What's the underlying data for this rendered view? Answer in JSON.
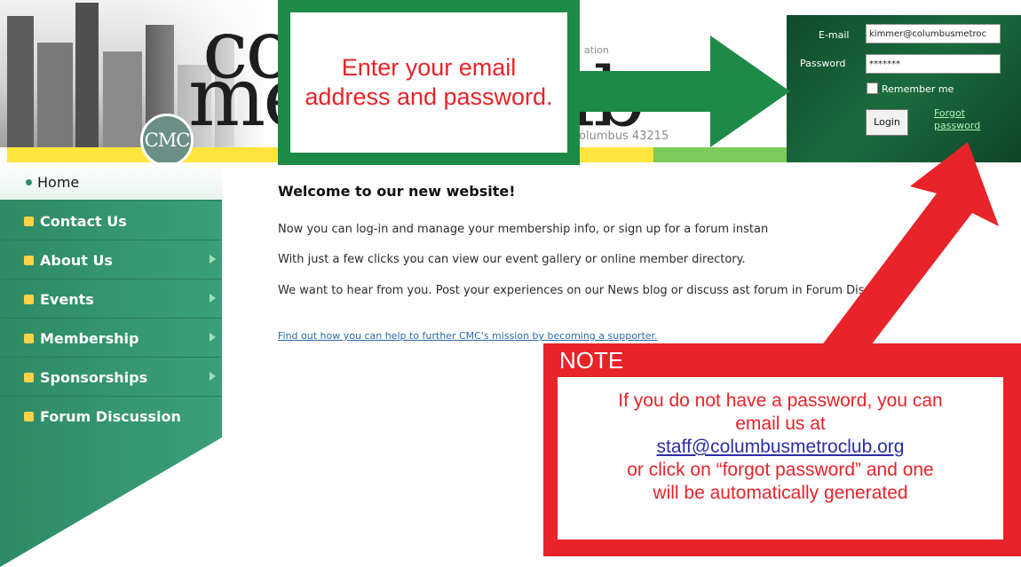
{
  "header": {
    "logo_badge": "CMC",
    "logo_word_1": "colu",
    "logo_word_2": "me",
    "logo_word_3": "ub",
    "tagline": "ation",
    "address": "olumbus 43215"
  },
  "login": {
    "email_label": "E-mail",
    "email_value": "kimmer@columbusmetroc",
    "password_label": "Password",
    "password_value": "*******",
    "remember_label": "Remember me",
    "login_button": "Login",
    "forgot_link": "Forgot password"
  },
  "nav": [
    {
      "label": "Home",
      "has_submenu": false,
      "active": true
    },
    {
      "label": "Contact Us",
      "has_submenu": false,
      "active": false
    },
    {
      "label": "About Us",
      "has_submenu": true,
      "active": false
    },
    {
      "label": "Events",
      "has_submenu": true,
      "active": false
    },
    {
      "label": "Membership",
      "has_submenu": true,
      "active": false
    },
    {
      "label": "Sponsorships",
      "has_submenu": true,
      "active": false
    },
    {
      "label": "Forum Discussion",
      "has_submenu": false,
      "active": false
    }
  ],
  "content": {
    "heading": "Welcome to our new website!",
    "para_1": "Now you can log-in and manage your membership info, or sign up for a forum instan",
    "para_2": "With just a few clicks you can view our event gallery or online member directory.",
    "para_3": "We want to hear from you.  Post your experiences on our News blog or discuss      ast forum in Forum Discussion.",
    "supporter_link": "Find out how you can help to further CMC's mission by becoming a supporter."
  },
  "callout_enter": {
    "text": "Enter your email address and password."
  },
  "note": {
    "title": "NOTE",
    "line_1": "If you do not have a password, you can",
    "line_2": "email us at",
    "email": "staff@columbusmetroclub.org",
    "line_3": "or click on “forgot password” and one",
    "line_4": "will be automatically generated"
  },
  "colors": {
    "accent_green": "#2e8a65",
    "callout_green": "#1e8a48",
    "callout_red": "#e8232a",
    "login_panel": "#0f4a2c",
    "stripe_yellow": "#ffe43c"
  }
}
